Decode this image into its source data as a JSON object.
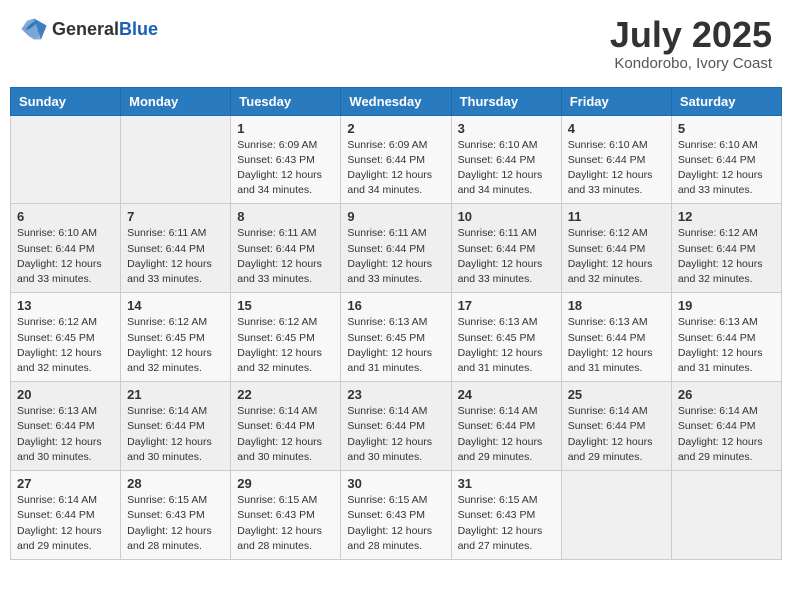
{
  "logo": {
    "general": "General",
    "blue": "Blue"
  },
  "header": {
    "month": "July 2025",
    "location": "Kondorobo, Ivory Coast"
  },
  "weekdays": [
    "Sunday",
    "Monday",
    "Tuesday",
    "Wednesday",
    "Thursday",
    "Friday",
    "Saturday"
  ],
  "weeks": [
    [
      {
        "day": "",
        "info": ""
      },
      {
        "day": "",
        "info": ""
      },
      {
        "day": "1",
        "info": "Sunrise: 6:09 AM\nSunset: 6:43 PM\nDaylight: 12 hours and 34 minutes."
      },
      {
        "day": "2",
        "info": "Sunrise: 6:09 AM\nSunset: 6:44 PM\nDaylight: 12 hours and 34 minutes."
      },
      {
        "day": "3",
        "info": "Sunrise: 6:10 AM\nSunset: 6:44 PM\nDaylight: 12 hours and 34 minutes."
      },
      {
        "day": "4",
        "info": "Sunrise: 6:10 AM\nSunset: 6:44 PM\nDaylight: 12 hours and 33 minutes."
      },
      {
        "day": "5",
        "info": "Sunrise: 6:10 AM\nSunset: 6:44 PM\nDaylight: 12 hours and 33 minutes."
      }
    ],
    [
      {
        "day": "6",
        "info": "Sunrise: 6:10 AM\nSunset: 6:44 PM\nDaylight: 12 hours and 33 minutes."
      },
      {
        "day": "7",
        "info": "Sunrise: 6:11 AM\nSunset: 6:44 PM\nDaylight: 12 hours and 33 minutes."
      },
      {
        "day": "8",
        "info": "Sunrise: 6:11 AM\nSunset: 6:44 PM\nDaylight: 12 hours and 33 minutes."
      },
      {
        "day": "9",
        "info": "Sunrise: 6:11 AM\nSunset: 6:44 PM\nDaylight: 12 hours and 33 minutes."
      },
      {
        "day": "10",
        "info": "Sunrise: 6:11 AM\nSunset: 6:44 PM\nDaylight: 12 hours and 33 minutes."
      },
      {
        "day": "11",
        "info": "Sunrise: 6:12 AM\nSunset: 6:44 PM\nDaylight: 12 hours and 32 minutes."
      },
      {
        "day": "12",
        "info": "Sunrise: 6:12 AM\nSunset: 6:44 PM\nDaylight: 12 hours and 32 minutes."
      }
    ],
    [
      {
        "day": "13",
        "info": "Sunrise: 6:12 AM\nSunset: 6:45 PM\nDaylight: 12 hours and 32 minutes."
      },
      {
        "day": "14",
        "info": "Sunrise: 6:12 AM\nSunset: 6:45 PM\nDaylight: 12 hours and 32 minutes."
      },
      {
        "day": "15",
        "info": "Sunrise: 6:12 AM\nSunset: 6:45 PM\nDaylight: 12 hours and 32 minutes."
      },
      {
        "day": "16",
        "info": "Sunrise: 6:13 AM\nSunset: 6:45 PM\nDaylight: 12 hours and 31 minutes."
      },
      {
        "day": "17",
        "info": "Sunrise: 6:13 AM\nSunset: 6:45 PM\nDaylight: 12 hours and 31 minutes."
      },
      {
        "day": "18",
        "info": "Sunrise: 6:13 AM\nSunset: 6:44 PM\nDaylight: 12 hours and 31 minutes."
      },
      {
        "day": "19",
        "info": "Sunrise: 6:13 AM\nSunset: 6:44 PM\nDaylight: 12 hours and 31 minutes."
      }
    ],
    [
      {
        "day": "20",
        "info": "Sunrise: 6:13 AM\nSunset: 6:44 PM\nDaylight: 12 hours and 30 minutes."
      },
      {
        "day": "21",
        "info": "Sunrise: 6:14 AM\nSunset: 6:44 PM\nDaylight: 12 hours and 30 minutes."
      },
      {
        "day": "22",
        "info": "Sunrise: 6:14 AM\nSunset: 6:44 PM\nDaylight: 12 hours and 30 minutes."
      },
      {
        "day": "23",
        "info": "Sunrise: 6:14 AM\nSunset: 6:44 PM\nDaylight: 12 hours and 30 minutes."
      },
      {
        "day": "24",
        "info": "Sunrise: 6:14 AM\nSunset: 6:44 PM\nDaylight: 12 hours and 29 minutes."
      },
      {
        "day": "25",
        "info": "Sunrise: 6:14 AM\nSunset: 6:44 PM\nDaylight: 12 hours and 29 minutes."
      },
      {
        "day": "26",
        "info": "Sunrise: 6:14 AM\nSunset: 6:44 PM\nDaylight: 12 hours and 29 minutes."
      }
    ],
    [
      {
        "day": "27",
        "info": "Sunrise: 6:14 AM\nSunset: 6:44 PM\nDaylight: 12 hours and 29 minutes."
      },
      {
        "day": "28",
        "info": "Sunrise: 6:15 AM\nSunset: 6:43 PM\nDaylight: 12 hours and 28 minutes."
      },
      {
        "day": "29",
        "info": "Sunrise: 6:15 AM\nSunset: 6:43 PM\nDaylight: 12 hours and 28 minutes."
      },
      {
        "day": "30",
        "info": "Sunrise: 6:15 AM\nSunset: 6:43 PM\nDaylight: 12 hours and 28 minutes."
      },
      {
        "day": "31",
        "info": "Sunrise: 6:15 AM\nSunset: 6:43 PM\nDaylight: 12 hours and 27 minutes."
      },
      {
        "day": "",
        "info": ""
      },
      {
        "day": "",
        "info": ""
      }
    ]
  ]
}
